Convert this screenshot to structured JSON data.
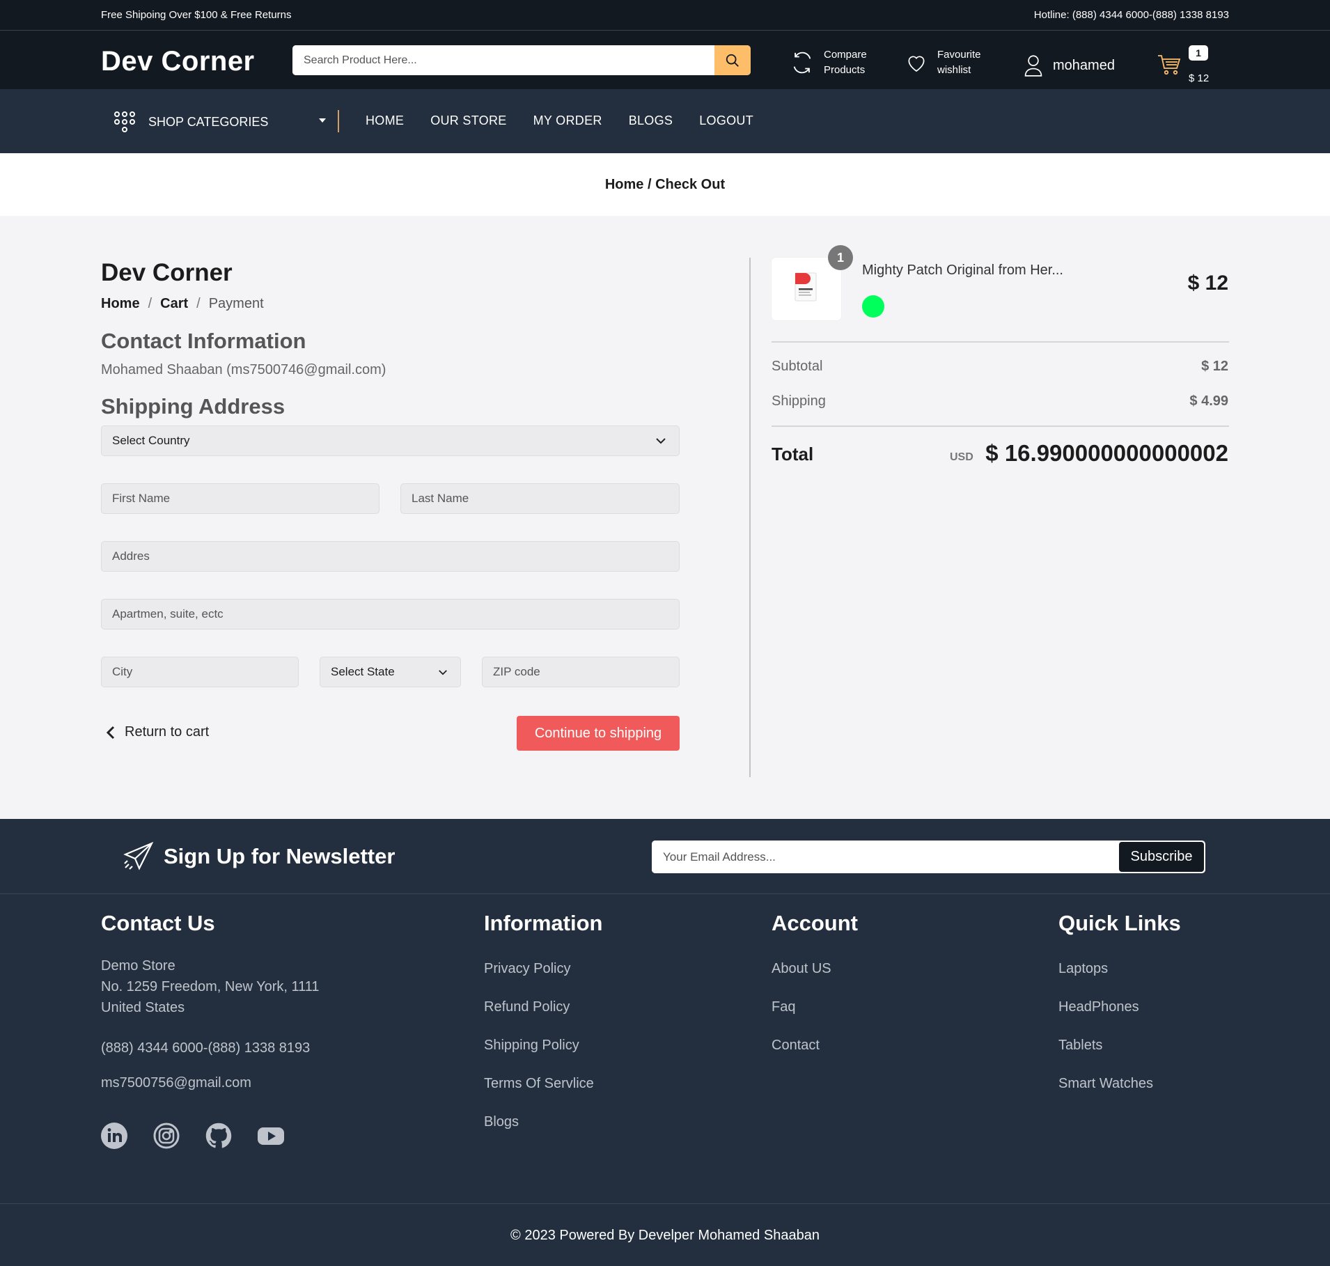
{
  "topbar": {
    "promo": "Free Shipoing Over $100 & Free Returns",
    "hotline": "Hotline: (888) 4344 6000-(888) 1338 8193"
  },
  "header": {
    "logo": "Dev Corner",
    "search_placeholder": "Search Product Here...",
    "compare_line1": "Compare",
    "compare_line2": "Products",
    "wishlist_line1": "Favourite",
    "wishlist_line2": "wishlist",
    "user": "mohamed",
    "cart_count": "1",
    "cart_total": "$ 12",
    "accent": "#febd69"
  },
  "nav": {
    "categories": "SHOP CATEGORIES",
    "items": [
      "HOME",
      "OUR STORE",
      "MY ORDER",
      "BLOGS",
      "LOGOUT"
    ]
  },
  "breadcrumb": "Home / Check Out",
  "checkout": {
    "store_title": "Dev Corner",
    "steps": [
      "Home",
      "/",
      "Cart",
      "/",
      "Payment"
    ],
    "contact_heading": "Contact Information",
    "contact_value": "Mohamed Shaaban (ms7500746@gmail.com)",
    "shipping_heading": "Shipping Address",
    "country": "Select Country",
    "first_name": "First Name",
    "last_name": "Last Name",
    "address": "Addres",
    "apartment": "Apartmen, suite, ectc",
    "city": "City",
    "state": "Select State",
    "zip": "ZIP code",
    "return_label": "Return to cart",
    "continue_label": "Continue to shipping",
    "continue_color": "#f05a5a"
  },
  "summary": {
    "qty": "1",
    "product_name": "Mighty Patch Original from Her...",
    "swatch_color": "#00ff5a",
    "product_price": "$ 12",
    "subtotal_label": "Subtotal",
    "subtotal_value": "$ 12",
    "shipping_label": "Shipping",
    "shipping_value": "$ 4.99",
    "total_label": "Total",
    "currency": "USD",
    "total_value": "$ 16.990000000000002"
  },
  "newsletter": {
    "title": "Sign Up for Newsletter",
    "placeholder": "Your Email Address...",
    "button": "Subscribe"
  },
  "footer": {
    "contact": {
      "title": "Contact Us",
      "store": "Demo Store",
      "street": "No. 1259 Freedom, New York, 1111",
      "country": "United States",
      "phone": "(888) 4344 6000-(888) 1338 8193",
      "email": "ms7500756@gmail.com",
      "social": [
        "linkedin-icon",
        "instagram-icon",
        "github-icon",
        "youtube-icon"
      ]
    },
    "information": {
      "title": "Information",
      "links": [
        "Privacy Policy",
        "Refund Policy",
        "Shipping Policy",
        "Terms Of Servlice",
        "Blogs"
      ]
    },
    "account": {
      "title": "Account",
      "links": [
        "About US",
        "Faq",
        "Contact"
      ]
    },
    "quick": {
      "title": "Quick Links",
      "links": [
        "Laptops",
        "HeadPhones",
        "Tablets",
        "Smart Watches"
      ]
    },
    "copyright": "© 2023 Powered By Develper Mohamed Shaaban"
  }
}
